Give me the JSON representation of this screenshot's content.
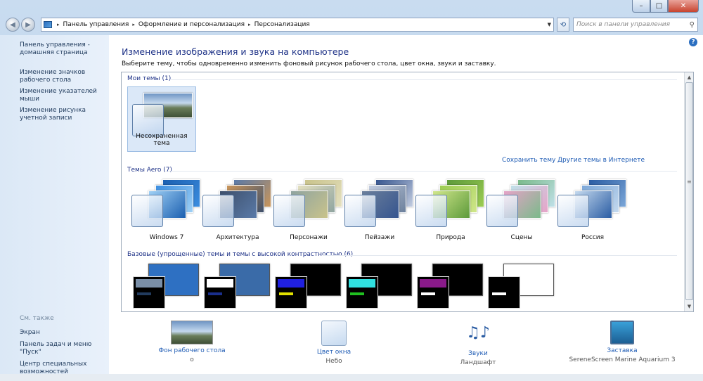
{
  "caption": {
    "min": "–",
    "max": "□",
    "close": "✕"
  },
  "nav": {
    "back": "◀",
    "forward": "▶",
    "breadcrumb": [
      "Панель управления",
      "Оформление и персонализация",
      "Персонализация"
    ],
    "separator": "▸",
    "dropdown": "▼",
    "refresh": "⟲",
    "search_placeholder": "Поиск в панели управления",
    "search_icon": "⚲"
  },
  "sidebar": {
    "home": "Панель управления - домашняя страница",
    "links": [
      "Изменение значков рабочего стола",
      "Изменение указателей мыши",
      "Изменение рисунка учетной записи"
    ],
    "see_also": "См. также",
    "also_links": [
      "Экран",
      "Панель задач и меню \"Пуск\"",
      "Центр специальных возможностей"
    ]
  },
  "main": {
    "help": "?",
    "title": "Изменение изображения и звука на компьютере",
    "description": "Выберите тему, чтобы одновременно изменить фоновый рисунок рабочего стола, цвет окна, звуки и заставку.",
    "my_themes_header": "Мои темы (1)",
    "my_themes": [
      {
        "label": "Несохраненная тема"
      }
    ],
    "save_theme": "Сохранить тему",
    "online_themes": "Другие темы в Интернете",
    "aero_header": "Темы Aero (7)",
    "aero_themes": [
      {
        "label": "Windows 7",
        "colors": [
          "#1b5fb0",
          "#3c8ee0",
          "#9fd0f5"
        ]
      },
      {
        "label": "Архитектура",
        "colors": [
          "#5a7aa8",
          "#c9955a",
          "#3d4f6b"
        ]
      },
      {
        "label": "Персонажи",
        "colors": [
          "#c9c38b",
          "#e4e0c0",
          "#8fa4a0"
        ]
      },
      {
        "label": "Пейзажи",
        "colors": [
          "#36558f",
          "#c3cde0",
          "#6b7f9b"
        ]
      },
      {
        "label": "Природа",
        "colors": [
          "#5c9a3a",
          "#9ccc52",
          "#d0e68a"
        ]
      },
      {
        "label": "Сцены",
        "colors": [
          "#7aba8a",
          "#c0e0e8",
          "#e6a3c8"
        ]
      },
      {
        "label": "Россия",
        "colors": [
          "#2a5ca3",
          "#7ca7d8",
          "#c4d9ee"
        ]
      }
    ],
    "basic_header": "Базовые (упрощенные) темы и темы с высокой контрастностью (6)",
    "basic_themes": [
      {
        "bg": "#2e70c2",
        "accent": "#7a8fa8",
        "bar": "#223b5e"
      },
      {
        "bg": "#3a6ba8",
        "accent": "#ffffff",
        "bar": "#1a2f8c"
      },
      {
        "bg": "#000000",
        "accent": "#2020e0",
        "bar": "#e0e000"
      },
      {
        "bg": "#000000",
        "accent": "#30e0e0",
        "bar": "#20c020"
      },
      {
        "bg": "#000000",
        "accent": "#8a1a8a",
        "bar": "#ffffff"
      },
      {
        "bg": "#ffffff",
        "accent": "#000000",
        "bar": "#ffffff"
      }
    ],
    "scroll_up": "▲",
    "scroll_down": "▼",
    "scroll_grip": "≡"
  },
  "bottom": [
    {
      "link": "Фон рабочего стола",
      "value": "о",
      "icon": "wallpaper-icon"
    },
    {
      "link": "Цвет окна",
      "value": "Небо",
      "icon": "window-color-icon"
    },
    {
      "link": "Звуки",
      "value": "Ландшафт",
      "icon": "sounds-icon",
      "glyph": "♫♪"
    },
    {
      "link": "Заставка",
      "value": "SereneScreen Marine Aquarium 3",
      "icon": "screensaver-icon"
    }
  ]
}
